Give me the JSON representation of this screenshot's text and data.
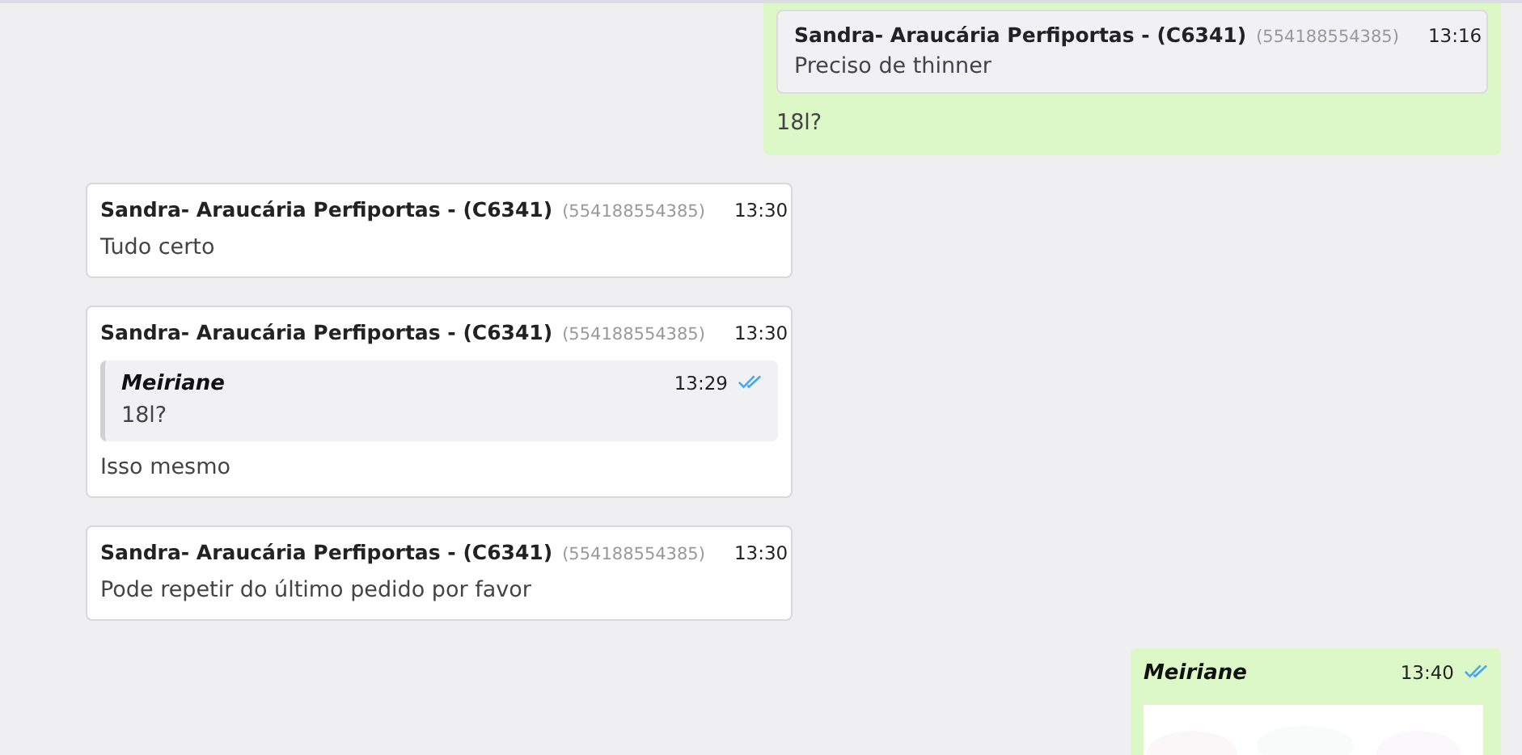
{
  "messages": [
    {
      "kind": "outgoing",
      "quote": {
        "sender": "Sandra- Araucária Perfiportas - (C6341)",
        "phone": "(554188554385)",
        "time": "13:16",
        "text": "Preciso de thinner"
      },
      "text": "18l?"
    },
    {
      "kind": "incoming",
      "sender": "Sandra- Araucária Perfiportas - (C6341)",
      "phone": "(554188554385)",
      "time": "13:30",
      "text": "Tudo certo"
    },
    {
      "kind": "incoming",
      "sender": "Sandra- Araucária Perfiportas - (C6341)",
      "phone": "(554188554385)",
      "time": "13:30",
      "quote": {
        "sender": "Meiriane",
        "time": "13:29",
        "read": true,
        "text": "18l?"
      },
      "text": "Isso mesmo"
    },
    {
      "kind": "incoming",
      "sender": "Sandra- Araucária Perfiportas - (C6341)",
      "phone": "(554188554385)",
      "time": "13:30",
      "text": "Pode repetir do último pedido por favor"
    },
    {
      "kind": "outgoing",
      "sender": "Meiriane",
      "time": "13:40",
      "read": true
    }
  ]
}
